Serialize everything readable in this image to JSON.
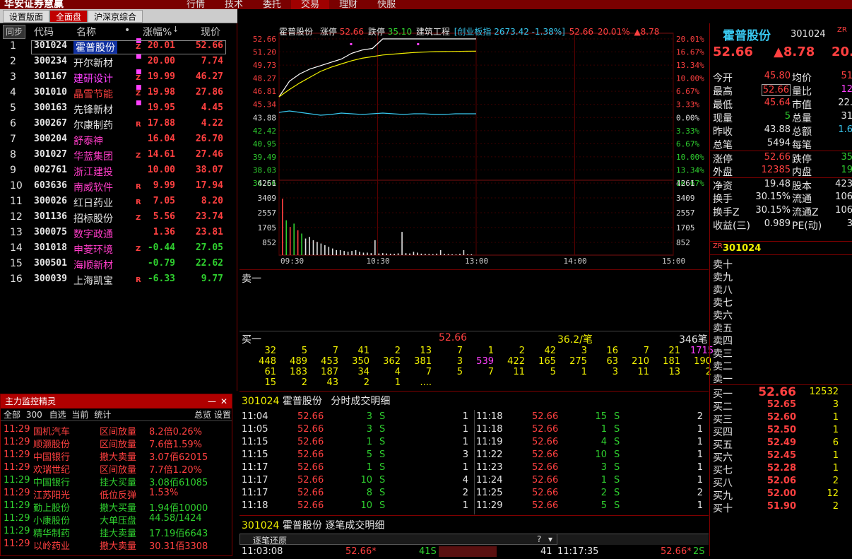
{
  "app": {
    "brand": "华安证券慧赢",
    "menu": [
      "行情",
      "技术",
      "委托",
      "交易",
      "理财",
      "快服"
    ],
    "menu_active": 3
  },
  "tabs": [
    "设置版面",
    "全面盘",
    "沪深京综合"
  ],
  "list": {
    "headers": {
      "sync": "同步",
      "code": "代码",
      "name": "名称",
      "dot": "•",
      "change": "涨幅%",
      "price": "现价"
    },
    "rows": [
      {
        "n": "1",
        "code": "301024",
        "name": "霍普股份",
        "flag": "Z",
        "chg": "20.01",
        "price": "52.66",
        "nc": "w",
        "cc": "r",
        "sel": true
      },
      {
        "n": "2",
        "code": "300234",
        "name": "开尔新材",
        "flag": "",
        "chg": "20.00",
        "price": "7.74",
        "nc": "w",
        "cc": "r"
      },
      {
        "n": "3",
        "code": "301167",
        "name": "建研设计",
        "flag": "Z",
        "chg": "19.99",
        "price": "46.27",
        "nc": "m",
        "cc": "r"
      },
      {
        "n": "4",
        "code": "301010",
        "name": "晶雪节能",
        "flag": "Z",
        "chg": "19.98",
        "price": "27.86",
        "nc": "r",
        "cc": "r"
      },
      {
        "n": "5",
        "code": "300163",
        "name": "先锋新材",
        "flag": "",
        "chg": "19.95",
        "price": "4.45",
        "nc": "w",
        "cc": "r"
      },
      {
        "n": "6",
        "code": "300267",
        "name": "尔康制药",
        "flag": "R",
        "chg": "17.88",
        "price": "4.22",
        "nc": "w",
        "cc": "r"
      },
      {
        "n": "7",
        "code": "300204",
        "name": "舒泰神",
        "flag": "",
        "chg": "16.04",
        "price": "26.70",
        "nc": "pk",
        "cc": "r"
      },
      {
        "n": "8",
        "code": "301027",
        "name": "华蓝集团",
        "flag": "Z",
        "chg": "14.61",
        "price": "27.46",
        "nc": "pk",
        "cc": "r"
      },
      {
        "n": "9",
        "code": "002761",
        "name": "浙江建投",
        "flag": "",
        "chg": "10.00",
        "price": "38.07",
        "nc": "pk",
        "cc": "r"
      },
      {
        "n": "10",
        "code": "603636",
        "name": "南威软件",
        "flag": "R",
        "chg": "9.99",
        "price": "17.94",
        "nc": "pk",
        "cc": "r"
      },
      {
        "n": "11",
        "code": "300026",
        "name": "红日药业",
        "flag": "R",
        "chg": "7.05",
        "price": "8.20",
        "nc": "w",
        "cc": "r"
      },
      {
        "n": "12",
        "code": "301136",
        "name": "招标股份",
        "flag": "Z",
        "chg": "5.56",
        "price": "23.74",
        "nc": "w",
        "cc": "r"
      },
      {
        "n": "13",
        "code": "300075",
        "name": "数字政通",
        "flag": "",
        "chg": "1.36",
        "price": "23.81",
        "nc": "pk",
        "cc": "r"
      },
      {
        "n": "14",
        "code": "301018",
        "name": "申菱环境",
        "flag": "Z",
        "chg": "-0.44",
        "price": "27.05",
        "nc": "pk",
        "cc": "g"
      },
      {
        "n": "15",
        "code": "300501",
        "name": "海顺新材",
        "flag": "",
        "chg": "-0.79",
        "price": "22.62",
        "nc": "pk",
        "cc": "g"
      },
      {
        "n": "16",
        "code": "300039",
        "name": "上海凯宝",
        "flag": "R",
        "chg": "-6.33",
        "price": "9.77",
        "nc": "w",
        "cc": "g"
      }
    ]
  },
  "monitor": {
    "title": "主力监控精灵",
    "close": "✕",
    "minimize": "—",
    "sub": {
      "all": "全部",
      "count": "300",
      "self": "自选",
      "current": "当前",
      "stat": "统计",
      "overview": "总览",
      "settings": "设置"
    },
    "rows": [
      {
        "t": "11:29",
        "name": "国机汽车",
        "type": "区间放量",
        "val": "8.2倍0.26%",
        "c": "r"
      },
      {
        "t": "11:29",
        "name": "顺灏股份",
        "type": "区间放量",
        "val": "7.6倍1.59%",
        "c": "r"
      },
      {
        "t": "11:29",
        "name": "中国银行",
        "type": "撤大卖量",
        "val": "3.07佰62015",
        "c": "r"
      },
      {
        "t": "11:29",
        "name": "欢瑞世纪",
        "type": "区间放量",
        "val": "7.7倍1.20%",
        "c": "r"
      },
      {
        "t": "11:29",
        "name": "中国银行",
        "type": "挂大买量",
        "val": "3.08佰61085",
        "c": "g"
      },
      {
        "t": "11:29",
        "name": "江苏阳光",
        "type": "低位反弹",
        "val": "1.53%",
        "c": "r"
      },
      {
        "t": "11:29",
        "name": "勤上股份",
        "type": "撤大买量",
        "val": "1.94佰10000",
        "c": "g"
      },
      {
        "t": "11:29",
        "name": "小康股份",
        "type": "大单压盘",
        "val": "44.58/1424",
        "c": "g"
      },
      {
        "t": "11:29",
        "name": "精华制药",
        "type": "挂大卖量",
        "val": "17.19佰6643",
        "c": "g"
      },
      {
        "t": "11:29",
        "name": "以岭药业",
        "type": "撤大卖量",
        "val": "30.31佰3308",
        "c": "r"
      }
    ]
  },
  "chart_data": {
    "type": "line",
    "header": {
      "name": "霍普股份",
      "limit_up_label": "涨停",
      "limit_up": "52.66",
      "limit_down_label": "跌停",
      "limit_down": "35.10",
      "sector": "建筑工程",
      "index": "[创业板指 2673.42 -1.38%]",
      "price": "52.66",
      "chg": "20.01%",
      "delta": "▲8.78"
    },
    "price_ticks": [
      "52.66",
      "51.20",
      "49.73",
      "48.27",
      "46.81",
      "45.34",
      "43.88",
      "42.42",
      "40.95",
      "39.49",
      "38.03",
      "36.56"
    ],
    "pct_ticks": [
      "20.01%",
      "16.67%",
      "13.34%",
      "10.00%",
      "6.67%",
      "3.33%",
      "0.00%",
      "3.33%",
      "6.67%",
      "10.00%",
      "13.34%",
      "16.67%"
    ],
    "vol_ticks": [
      "4261",
      "3409",
      "2557",
      "1705",
      "852"
    ],
    "time_ticks": [
      "09:30",
      "10:30",
      "13:00",
      "14:00",
      "15:00"
    ],
    "ylim": [
      35.1,
      52.66
    ],
    "prev_close": 43.88,
    "vol_max": 4261,
    "price_series": [
      45.6,
      47.5,
      48.4,
      49.0,
      49.4,
      49.8,
      50.2,
      50.9,
      51.3,
      51.5,
      52.66,
      52.66,
      52.66,
      52.66,
      52.66,
      52.66,
      52.66,
      52.66,
      52.66,
      52.66
    ],
    "avg_series": [
      45.6,
      46.5,
      47.3,
      48.0,
      48.7,
      49.2,
      49.6,
      50.0,
      50.3,
      50.5,
      50.7,
      50.8,
      50.9,
      51.0,
      51.05,
      51.1,
      51.12,
      51.14,
      51.15,
      51.16
    ],
    "index_series": [
      0.1,
      0.2,
      0.1,
      0.0,
      -0.1,
      -0.05,
      0.05,
      0.0,
      -0.05,
      0.0,
      0.05,
      0.0,
      -0.05,
      0.0,
      0.0,
      -0.05,
      -0.05,
      0.0,
      0.0,
      0.0
    ],
    "volume_series": [
      3400,
      2100,
      1700,
      1900,
      1500,
      1300,
      1000,
      1100,
      900,
      800,
      700,
      600,
      500,
      400,
      300,
      300,
      250,
      200,
      250,
      300,
      200,
      150,
      150,
      120,
      900,
      100,
      120,
      100,
      90,
      80,
      110,
      1400,
      120,
      100,
      200,
      150,
      90,
      80,
      70,
      60,
      90,
      300,
      70,
      60,
      50,
      40,
      80,
      300,
      40,
      50
    ]
  },
  "quote": {
    "name": "霍普股份",
    "code": "301024",
    "tag": "ZR",
    "price": "52.66",
    "delta": "▲8.78",
    "chg": "20.01",
    "rows": [
      {
        "l": "今开",
        "v": "45.80",
        "vc": "r",
        "l2": "均价",
        "v2": "51",
        "v2c": "r"
      },
      {
        "l": "最高",
        "v": "52.66",
        "vc": "r",
        "l2": "量比",
        "v2": "12",
        "v2c": "m"
      },
      {
        "l": "最低",
        "v": "45.64",
        "vc": "r",
        "l2": "市值",
        "v2": "22.",
        "v2c": "w"
      },
      {
        "l": "现量",
        "v": "5",
        "vc": "g",
        "l2": "总量",
        "v2": "31",
        "v2c": "w"
      },
      {
        "l": "昨收",
        "v": "43.88",
        "vc": "w",
        "l2": "总额",
        "v2": "1.6",
        "v2c": "c"
      },
      {
        "l": "总笔",
        "v": "5494",
        "vc": "w",
        "l2": "每笔",
        "v2": "",
        "v2c": "w"
      },
      {
        "l": "涨停",
        "v": "52.66",
        "vc": "r",
        "l2": "跌停",
        "v2": "35",
        "v2c": "g"
      },
      {
        "l": "外盘",
        "v": "12385",
        "vc": "r",
        "l2": "内盘",
        "v2": "19",
        "v2c": "g"
      },
      {
        "l": "净资",
        "v": "19.48",
        "vc": "w",
        "l2": "股本",
        "v2": "423",
        "v2c": "w"
      },
      {
        "l": "换手",
        "v": "30.15%",
        "vc": "w",
        "l2": "流通",
        "v2": "106",
        "v2c": "w"
      },
      {
        "l": "换手Z",
        "v": "30.15%",
        "vc": "w",
        "l2": "流通Z",
        "v2": "106",
        "v2c": "w"
      },
      {
        "l": "收益(三)",
        "v": "0.989",
        "vc": "w",
        "l2": "PE(动)",
        "v2": "3",
        "v2c": "w"
      }
    ],
    "book_title": "霍普股份",
    "book_code": "301024",
    "book_tag": "ZR",
    "sells": [
      "卖十",
      "卖九",
      "卖八",
      "卖七",
      "卖六",
      "卖五",
      "卖四",
      "卖三",
      "卖二",
      "卖一"
    ],
    "buys": [
      {
        "l": "买一",
        "p": "52.66",
        "q": "12532"
      },
      {
        "l": "买二",
        "p": "52.65",
        "q": "3"
      },
      {
        "l": "买三",
        "p": "52.60",
        "q": "1"
      },
      {
        "l": "买四",
        "p": "52.50",
        "q": "1"
      },
      {
        "l": "买五",
        "p": "52.49",
        "q": "6"
      },
      {
        "l": "买六",
        "p": "52.45",
        "q": "1"
      },
      {
        "l": "买七",
        "p": "52.28",
        "q": "1"
      },
      {
        "l": "买八",
        "p": "52.06",
        "q": "2"
      },
      {
        "l": "买九",
        "p": "52.00",
        "q": "12"
      },
      {
        "l": "买十",
        "p": "51.90",
        "q": "2"
      }
    ]
  },
  "mid": {
    "sell1": "卖一",
    "buy1": "买一",
    "buy1_price": "52.66",
    "per_trade": "36.2/笔",
    "buy1_qty": "346笔",
    "grid": [
      [
        "32",
        "5",
        "7",
        "41",
        "2",
        "13",
        "7",
        "1",
        "2",
        "42",
        "3",
        "16",
        "7",
        "21",
        "1715"
      ],
      [
        "448",
        "489",
        "453",
        "350",
        "362",
        "381",
        "3",
        "539",
        "422",
        "165",
        "275",
        "63",
        "210",
        "181",
        "190"
      ],
      [
        "61",
        "183",
        "187",
        "34",
        "4",
        "7",
        "5",
        "7",
        "11",
        "5",
        "1",
        "3",
        "11",
        "13",
        "2"
      ],
      [
        "15",
        "2",
        "43",
        "2",
        "1",
        "....",
        "",
        "",
        "",
        "",
        "",
        "",
        "",
        "",
        ""
      ]
    ]
  },
  "trades": {
    "title_code": "301024",
    "title_name": "霍普股份",
    "title_text": "分时成交明细",
    "left": [
      {
        "t": "11:04",
        "p": "52.66",
        "v": "3",
        "s": "S",
        "n": "1"
      },
      {
        "t": "11:05",
        "p": "52.66",
        "v": "3",
        "s": "S",
        "n": "1"
      },
      {
        "t": "11:15",
        "p": "52.66",
        "v": "1",
        "s": "S",
        "n": "1"
      },
      {
        "t": "11:15",
        "p": "52.66",
        "v": "5",
        "s": "S",
        "n": "3"
      },
      {
        "t": "11:17",
        "p": "52.66",
        "v": "1",
        "s": "S",
        "n": "1"
      },
      {
        "t": "11:17",
        "p": "52.66",
        "v": "10",
        "s": "S",
        "n": "4"
      },
      {
        "t": "11:17",
        "p": "52.66",
        "v": "8",
        "s": "S",
        "n": "2"
      },
      {
        "t": "11:18",
        "p": "52.66",
        "v": "10",
        "s": "S",
        "n": "1"
      }
    ],
    "right": [
      {
        "t": "11:18",
        "p": "52.66",
        "v": "15",
        "s": "S",
        "n": "2"
      },
      {
        "t": "11:18",
        "p": "52.66",
        "v": "1",
        "s": "S",
        "n": "1"
      },
      {
        "t": "11:19",
        "p": "52.66",
        "v": "4",
        "s": "S",
        "n": "1"
      },
      {
        "t": "11:22",
        "p": "52.66",
        "v": "10",
        "s": "S",
        "n": "1"
      },
      {
        "t": "11:23",
        "p": "52.66",
        "v": "3",
        "s": "S",
        "n": "1"
      },
      {
        "t": "11:24",
        "p": "52.66",
        "v": "1",
        "s": "S",
        "n": "1"
      },
      {
        "t": "11:25",
        "p": "52.66",
        "v": "2",
        "s": "S",
        "n": "2"
      },
      {
        "t": "11:29",
        "p": "52.66",
        "v": "5",
        "s": "S",
        "n": "1"
      }
    ]
  },
  "bottom": {
    "title_code": "301024",
    "title_name": "霍普股份",
    "title_text": "逐笔成交明细",
    "restore": "逐笔还原",
    "q": "?",
    "dropdown": "▾",
    "row": {
      "t1": "11:03:08",
      "p1": "52.66*",
      "v1": "41S",
      "v1b": "41",
      "t2": "11:17:35",
      "p2": "52.66*",
      "v2": "2S"
    }
  }
}
